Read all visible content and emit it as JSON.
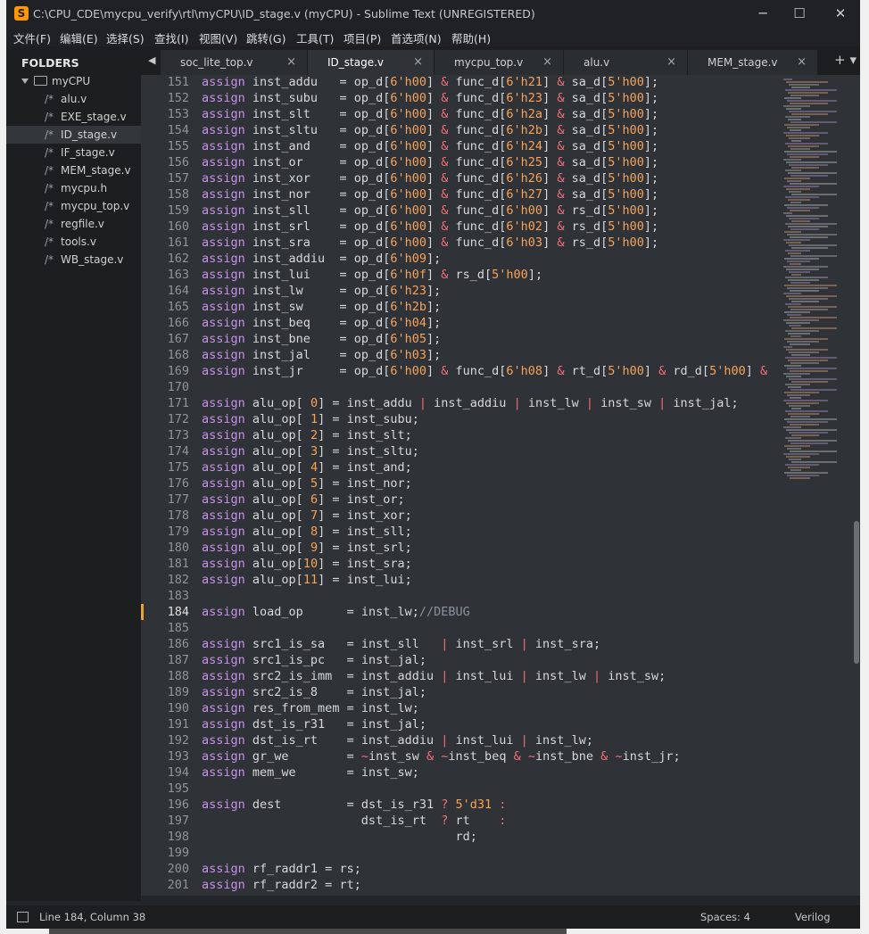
{
  "window": {
    "title": "C:\\CPU_CDE\\mycpu_verify\\rtl\\myCPU\\ID_stage.v (myCPU) - Sublime Text (UNREGISTERED)",
    "logo": "S",
    "controls": {
      "minimize": "─",
      "maximize": "☐",
      "close": "✕"
    }
  },
  "menu": [
    "文件(F)",
    "编辑(E)",
    "选择(S)",
    "查找(I)",
    "视图(V)",
    "跳转(G)",
    "工具(T)",
    "项目(P)",
    "首选项(N)",
    "帮助(H)"
  ],
  "sidebar": {
    "header": "FOLDERS",
    "folder": "myCPU",
    "comment_prefix": "/*",
    "files": [
      "alu.v",
      "EXE_stage.v",
      "ID_stage.v",
      "IF_stage.v",
      "MEM_stage.v",
      "mycpu.h",
      "mycpu_top.v",
      "regfile.v",
      "tools.v",
      "WB_stage.v"
    ],
    "selected_index": 2
  },
  "tabs": {
    "nav": "◀ ▶",
    "tools": "+ ▾",
    "items": [
      {
        "label": "soc_lite_top.v",
        "active": false
      },
      {
        "label": "ID_stage.v",
        "active": true
      },
      {
        "label": "mycpu_top.v",
        "active": false
      },
      {
        "label": "alu.v",
        "active": false
      },
      {
        "label": "MEM_stage.v",
        "active": false
      }
    ],
    "close_glyph": "×"
  },
  "editor": {
    "first_line": 151,
    "current_line": 184,
    "lines": [
      "assign inst_addu   = op_d[6'h00] & func_d[6'h21] & sa_d[5'h00];",
      "assign inst_subu   = op_d[6'h00] & func_d[6'h23] & sa_d[5'h00];",
      "assign inst_slt    = op_d[6'h00] & func_d[6'h2a] & sa_d[5'h00];",
      "assign inst_sltu   = op_d[6'h00] & func_d[6'h2b] & sa_d[5'h00];",
      "assign inst_and    = op_d[6'h00] & func_d[6'h24] & sa_d[5'h00];",
      "assign inst_or     = op_d[6'h00] & func_d[6'h25] & sa_d[5'h00];",
      "assign inst_xor    = op_d[6'h00] & func_d[6'h26] & sa_d[5'h00];",
      "assign inst_nor    = op_d[6'h00] & func_d[6'h27] & sa_d[5'h00];",
      "assign inst_sll    = op_d[6'h00] & func_d[6'h00] & rs_d[5'h00];",
      "assign inst_srl    = op_d[6'h00] & func_d[6'h02] & rs_d[5'h00];",
      "assign inst_sra    = op_d[6'h00] & func_d[6'h03] & rs_d[5'h00];",
      "assign inst_addiu  = op_d[6'h09];",
      "assign inst_lui    = op_d[6'h0f] & rs_d[5'h00];",
      "assign inst_lw     = op_d[6'h23];",
      "assign inst_sw     = op_d[6'h2b];",
      "assign inst_beq    = op_d[6'h04];",
      "assign inst_bne    = op_d[6'h05];",
      "assign inst_jal    = op_d[6'h03];",
      "assign inst_jr     = op_d[6'h00] & func_d[6'h08] & rt_d[5'h00] & rd_d[5'h00] &",
      "",
      "assign alu_op[ 0] = inst_addu | inst_addiu | inst_lw | inst_sw | inst_jal;",
      "assign alu_op[ 1] = inst_subu;",
      "assign alu_op[ 2] = inst_slt;",
      "assign alu_op[ 3] = inst_sltu;",
      "assign alu_op[ 4] = inst_and;",
      "assign alu_op[ 5] = inst_nor;",
      "assign alu_op[ 6] = inst_or;",
      "assign alu_op[ 7] = inst_xor;",
      "assign alu_op[ 8] = inst_sll;",
      "assign alu_op[ 9] = inst_srl;",
      "assign alu_op[10] = inst_sra;",
      "assign alu_op[11] = inst_lui;",
      "",
      "assign load_op      = inst_lw;//DEBUG",
      "",
      "assign src1_is_sa   = inst_sll   | inst_srl | inst_sra;",
      "assign src1_is_pc   = inst_jal;",
      "assign src2_is_imm  = inst_addiu | inst_lui | inst_lw | inst_sw;",
      "assign src2_is_8    = inst_jal;",
      "assign res_from_mem = inst_lw;",
      "assign dst_is_r31   = inst_jal;",
      "assign dst_is_rt    = inst_addiu | inst_lui | inst_lw;",
      "assign gr_we        = ~inst_sw & ~inst_beq & ~inst_bne & ~inst_jr;",
      "assign mem_we       = inst_sw;",
      "",
      "assign dest         = dst_is_r31 ? 5'd31 :",
      "                      dst_is_rt  ? rt    :",
      "                                   rd;",
      "",
      "assign rf_raddr1 = rs;",
      "assign rf_raddr2 = rt;"
    ]
  },
  "status": {
    "position": "Line 184, Column 38",
    "spaces": "Spaces: 4",
    "syntax": "Verilog"
  },
  "colors": {
    "keyword": "#c792ea",
    "number": "#f6a35b",
    "operator": "#f07178",
    "comment": "#8a939c",
    "text": "#d6d8da",
    "editor_bg": "#2f3236",
    "modified_marker": "#f0a030"
  }
}
